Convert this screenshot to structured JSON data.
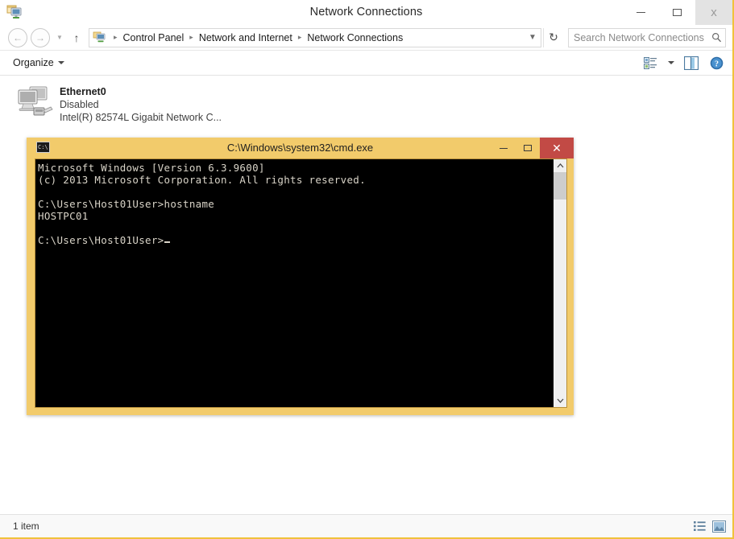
{
  "explorer": {
    "title": "Network Connections",
    "window_controls": {
      "minimize": "minimize-icon",
      "maximize": "maximize-icon",
      "close": "x"
    },
    "nav": {
      "back": "back-arrow-icon",
      "forward": "forward-arrow-icon",
      "recent_pages": "chevron-down-icon",
      "up": "up-arrow-icon",
      "address_icon": "network-connections-icon",
      "breadcrumbs": [
        "Control Panel",
        "Network and Internet",
        "Network Connections"
      ],
      "breadcrumb_separator": "▸",
      "address_dropdown": "chevron-down-icon",
      "refresh": "refresh-icon"
    },
    "search": {
      "placeholder": "Search Network Connections",
      "icon": "search-icon"
    },
    "toolbar": {
      "organize_label": "Organize",
      "organize_caret": "chevron-down-icon",
      "change_view_icon": "change-view-icon",
      "change_view_caret": "chevron-down-icon",
      "preview_pane_icon": "preview-pane-icon",
      "help_icon": "help-icon"
    },
    "items": [
      {
        "name": "Ethernet0",
        "status": "Disabled",
        "adapter": "Intel(R) 82574L Gigabit Network C...",
        "icon": "network-adapter-disabled-icon"
      }
    ],
    "statusbar": {
      "count_text": "1 item",
      "details_view_icon": "details-view-icon",
      "large_icons_view_icon": "large-icons-view-icon"
    }
  },
  "cmd": {
    "title": "C:\\Windows\\system32\\cmd.exe",
    "titlebar_icon": "cmd-console-icon",
    "window_controls": {
      "minimize": "minimize-icon",
      "maximize": "maximize-icon",
      "close": "✕"
    },
    "console_lines": [
      "Microsoft Windows [Version 6.3.9600]",
      "(c) 2013 Microsoft Corporation. All rights reserved.",
      "",
      "C:\\Users\\Host01User>hostname",
      "HOSTPC01",
      "",
      "C:\\Users\\Host01User>"
    ],
    "scrollbar": {
      "up_arrow": "⌃",
      "down_arrow": "⌄"
    }
  },
  "colors": {
    "cmd_frame": "#f2cb6b",
    "cmd_close_button": "#c24a45",
    "console_background": "#000000",
    "console_text": "#d9d4c8",
    "explorer_focus_border": "#f0c23c"
  }
}
